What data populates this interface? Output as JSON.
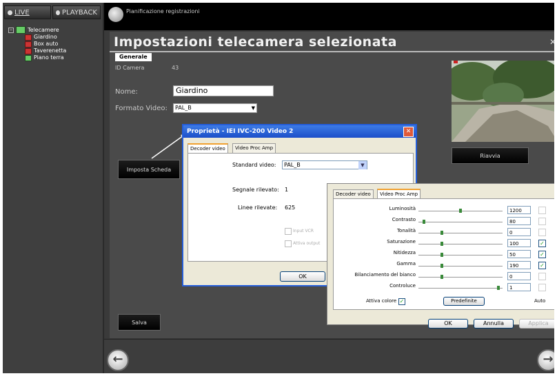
{
  "topbar": {
    "live_label": "LIVE",
    "playback_label": "PLAYBACK"
  },
  "tree": {
    "root": "Telecamere",
    "items": [
      "Giardino",
      "Box auto",
      "Taverenetta",
      "Piano terra"
    ]
  },
  "header": {
    "planner_label": "Pianificazione registrazioni"
  },
  "panel": {
    "title": "Impostazioni telecamera selezionata",
    "tab_label": "Generale",
    "id_label": "ID Camera",
    "id_value": "43",
    "name_label": "Nome:",
    "name_value": "Giardino",
    "format_label": "Formato Video:",
    "format_value": "PAL_B",
    "set_card_button": "Imposta Scheda",
    "save_button": "Salva",
    "restart_button": "Riavvia"
  },
  "dialog1": {
    "title": "Proprietà - IEI IVC-200 Video 2",
    "tab_decoder": "Decoder video",
    "tab_proc": "Video Proc Amp",
    "standard_label": "Standard video:",
    "standard_value": "PAL_B",
    "signal_label": "Segnale rilevato:",
    "signal_value": "1",
    "lines_label": "Linee rilevate:",
    "lines_value": "625",
    "vcr_label": "Input VCR",
    "output_label": "Attiva output",
    "ok_label": "OK"
  },
  "dialog2": {
    "tab_decoder": "Decoder video",
    "tab_proc": "Video Proc Amp",
    "sliders": [
      {
        "name": "Luminosità",
        "value": "1200",
        "pos": 0.5,
        "auto": false,
        "auto_enabled": false
      },
      {
        "name": "Contrasto",
        "value": "80",
        "pos": 0.05,
        "auto": false,
        "auto_enabled": false
      },
      {
        "name": "Tonalità",
        "value": "0",
        "pos": 0.27,
        "auto": false,
        "auto_enabled": false
      },
      {
        "name": "Saturazione",
        "value": "100",
        "pos": 0.27,
        "auto": true,
        "auto_enabled": true
      },
      {
        "name": "Nitidezza",
        "value": "50",
        "pos": 0.27,
        "auto": true,
        "auto_enabled": true
      },
      {
        "name": "Gamma",
        "value": "190",
        "pos": 0.27,
        "auto": true,
        "auto_enabled": true
      },
      {
        "name": "Bilanciamento del bianco",
        "value": "0",
        "pos": 0.27,
        "auto": false,
        "auto_enabled": false
      },
      {
        "name": "Controluce",
        "value": "1",
        "pos": 0.97,
        "auto": false,
        "auto_enabled": false
      }
    ],
    "color_enable_label": "Attiva colore",
    "defaults_button": "Predefinite",
    "auto_label": "Auto",
    "ok_label": "OK",
    "cancel_label": "Annulla",
    "apply_label": "Applica"
  }
}
